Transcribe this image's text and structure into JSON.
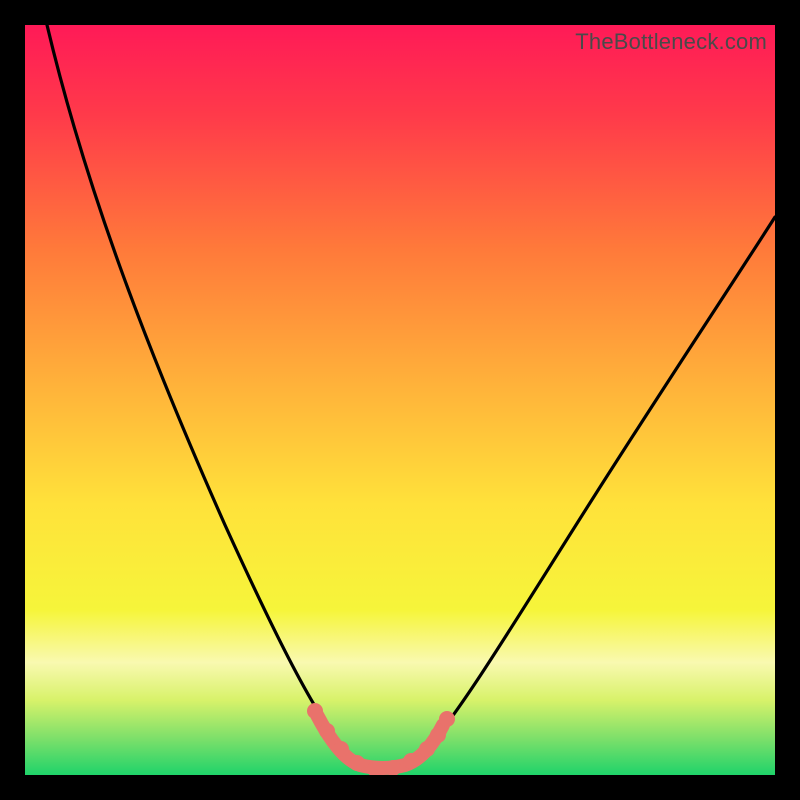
{
  "watermark": "TheBottleneck.com",
  "chart_data": {
    "type": "line",
    "title": "",
    "xlabel": "",
    "ylabel": "",
    "xlim": [
      0,
      100
    ],
    "ylim": [
      0,
      100
    ],
    "series": [
      {
        "name": "bottleneck-curve",
        "x": [
          3,
          10,
          20,
          30,
          35,
          38,
          40,
          42,
          44,
          46,
          48,
          50,
          52,
          56,
          60,
          70,
          80,
          90,
          100
        ],
        "y": [
          100,
          85,
          63,
          40,
          27,
          18,
          10,
          5,
          2,
          1,
          1,
          2,
          5,
          12,
          20,
          36,
          50,
          63,
          75
        ],
        "note": "Approximate V-shaped bottleneck curve; minimum around x≈46-48; right branch exits near y≈75 at x=100."
      },
      {
        "name": "highlight-segment",
        "x": [
          38,
          40,
          42,
          44,
          46,
          48,
          50,
          52,
          54,
          56
        ],
        "y": [
          11,
          6,
          3,
          1.5,
          1.2,
          1.2,
          1.8,
          4,
          7,
          12
        ],
        "note": "Thick pink/coral highlighted bottom of the curve with dot markers."
      }
    ],
    "gradient_stops": [
      {
        "pct": 0,
        "color": "#ff1a57"
      },
      {
        "pct": 12,
        "color": "#ff3a4a"
      },
      {
        "pct": 30,
        "color": "#ff7a3a"
      },
      {
        "pct": 48,
        "color": "#ffb23a"
      },
      {
        "pct": 64,
        "color": "#ffe23a"
      },
      {
        "pct": 78,
        "color": "#f6f53a"
      },
      {
        "pct": 85,
        "color": "#f9f9b0"
      },
      {
        "pct": 90,
        "color": "#d8f26a"
      },
      {
        "pct": 95,
        "color": "#7fe06a"
      },
      {
        "pct": 100,
        "color": "#1fd36a"
      }
    ],
    "highlight_color": "#e9726b",
    "curve_color": "#000000"
  }
}
